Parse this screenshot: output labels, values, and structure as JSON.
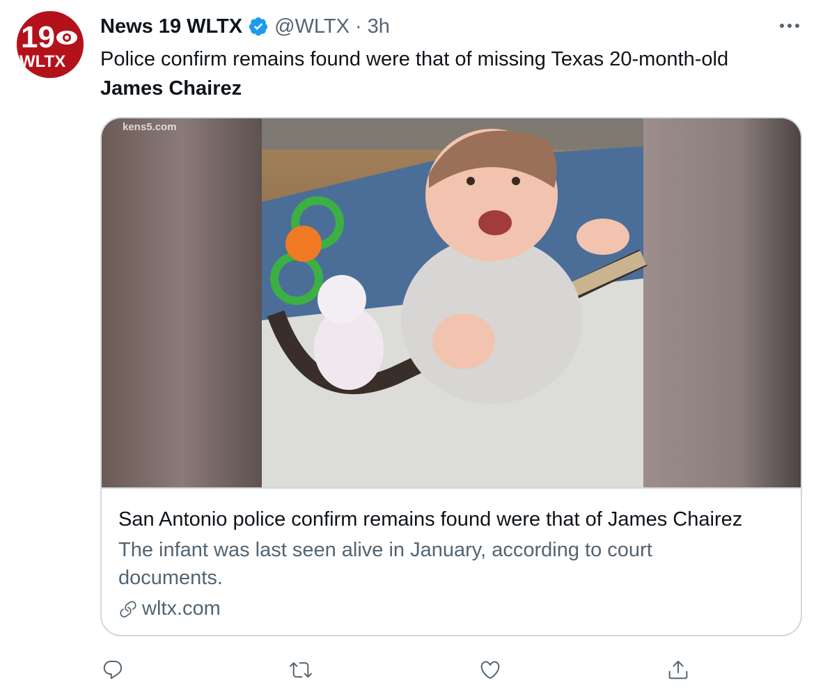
{
  "author": {
    "display_name": "News 19 WLTX",
    "handle": "@WLTX",
    "separator": "·",
    "time": "3h",
    "avatar_text_top": "19",
    "avatar_text_bottom": "WLTX",
    "verified": true
  },
  "tweet": {
    "text_line1": "Police confirm remains found were that of missing Texas 20-month-old",
    "text_line2": "James Chairez"
  },
  "card": {
    "watermark": "kens5.com",
    "title": "San Antonio police confirm remains found were that of James Chairez",
    "description": "The infant was last seen alive in January, according to court documents.",
    "domain": "wltx.com"
  },
  "icons": {
    "more": "more-horizontal-icon",
    "reply": "reply-icon",
    "retweet": "retweet-icon",
    "like": "heart-icon",
    "share": "share-icon",
    "link": "link-icon",
    "verified": "verified-badge-icon"
  },
  "colors": {
    "text": "#0f1419",
    "secondary": "#536471",
    "verified": "#1d9bf0",
    "border": "#cfd9de",
    "brand": "#b4121b"
  }
}
